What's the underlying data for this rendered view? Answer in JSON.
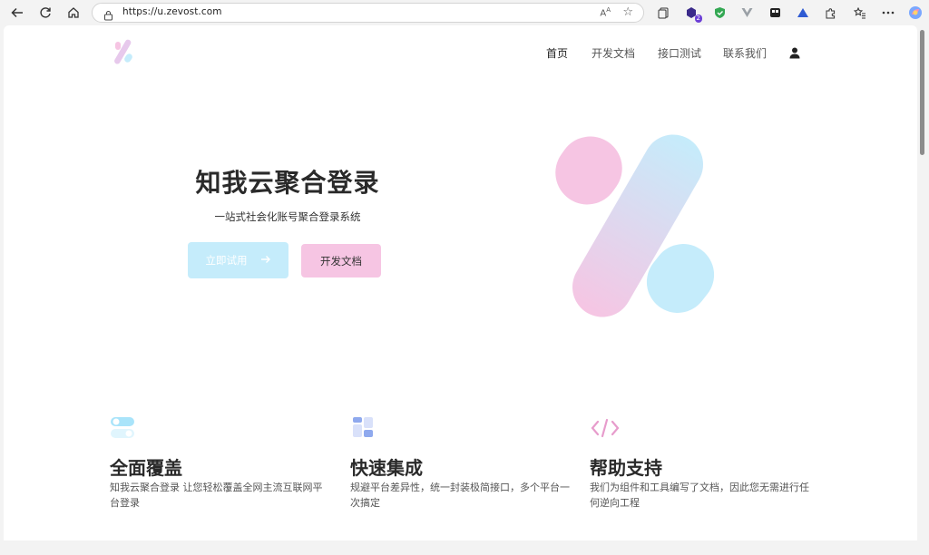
{
  "browser": {
    "url": "https://u.zevost.com",
    "reader_label": "A",
    "extension_badge": "2"
  },
  "site": {
    "nav": [
      {
        "label": "首页"
      },
      {
        "label": "开发文档"
      },
      {
        "label": "接口测试"
      },
      {
        "label": "联系我们"
      }
    ]
  },
  "hero": {
    "title": "知我云聚合登录",
    "subtitle": "一站式社会化账号聚合登录系统",
    "primary_button": "立即试用",
    "secondary_button": "开发文档"
  },
  "features": [
    {
      "icon": "toggle-icon",
      "title": "全面覆盖",
      "desc": "知我云聚合登录 让您轻松覆盖全网主流互联网平台登录"
    },
    {
      "icon": "layout-blocks-icon",
      "title": "快速集成",
      "desc": "规避平台差异性，统一封装极简接口，多个平台一次搞定"
    },
    {
      "icon": "code-icon",
      "title": "帮助支持",
      "desc": "我们为组件和工具编写了文档，因此您无需进行任何逆向工程"
    }
  ],
  "colors": {
    "brand_pink": "#f6c5e3",
    "brand_blue": "#c5ecfb"
  }
}
